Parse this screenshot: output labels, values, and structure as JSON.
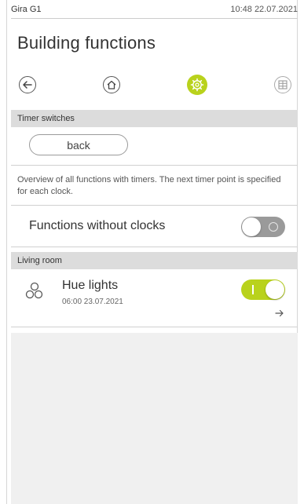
{
  "status": {
    "device": "Gira G1",
    "datetime": "10:48 22.07.2021"
  },
  "page": {
    "title": "Building functions"
  },
  "nav": {
    "back_icon": "arrow-left-icon",
    "home_icon": "home-icon",
    "settings_icon": "gear-icon",
    "grid_icon": "grid-icon",
    "accent": "#b9d21c"
  },
  "timer_section": {
    "header": "Timer switches",
    "back_label": "back",
    "description": "Overview of all functions with timers. The next timer point is specified for each clock."
  },
  "functions_without_clocks": {
    "label": "Functions without clocks",
    "state": "off"
  },
  "room_section": {
    "header": "Living room",
    "item": {
      "name": "Hue lights",
      "next_timer": "06:00 23.07.2021",
      "state": "on",
      "icon": "hue-lights-icon",
      "more_icon": "arrow-right-icon"
    }
  }
}
